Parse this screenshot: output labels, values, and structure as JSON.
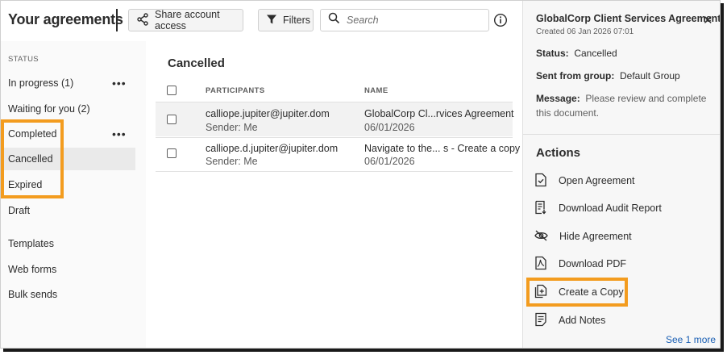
{
  "header": {
    "title": "Your agreements",
    "share_label": "Share account access",
    "filters_label": "Filters",
    "search_placeholder": "Search"
  },
  "sidebar": {
    "section_label": "STATUS",
    "items": [
      {
        "label": "In progress (1)"
      },
      {
        "label": "Waiting for you (2)"
      },
      {
        "label": "Completed"
      },
      {
        "label": "Cancelled"
      },
      {
        "label": "Expired"
      },
      {
        "label": "Draft"
      },
      {
        "label": "Templates"
      },
      {
        "label": "Web forms"
      },
      {
        "label": "Bulk sends"
      }
    ],
    "selected": "Cancelled",
    "highlighted": [
      "Completed",
      "Cancelled",
      "Expired"
    ]
  },
  "list": {
    "heading": "Cancelled",
    "columns": [
      "PARTICIPANTS",
      "NAME"
    ],
    "rows": [
      {
        "participant": "calliope.jupiter@jupiter.dom",
        "sender": "Sender: Me",
        "name": "GlobalCorp Cl...rvices Agreement",
        "date": "06/01/2026"
      },
      {
        "participant": "calliope.d.jupiter@jupiter.dom",
        "sender": "Sender: Me",
        "name": "Navigate to the... s - Create a copy",
        "date": "06/01/2026"
      }
    ]
  },
  "details": {
    "title": "GlobalCorp Client Services Agreement",
    "created": "Created 06 Jan 2026 07:01",
    "status_label": "Status:",
    "status_value": "Cancelled",
    "group_label": "Sent from group:",
    "group_value": "Default Group",
    "message_label": "Message:",
    "message_value": "Please review and complete this document.",
    "actions_title": "Actions",
    "actions": [
      {
        "label": "Open Agreement",
        "icon": "document-check-icon"
      },
      {
        "label": "Download Audit Report",
        "icon": "audit-report-icon"
      },
      {
        "label": "Hide Agreement",
        "icon": "eye-hidden-icon"
      },
      {
        "label": "Download PDF",
        "icon": "pdf-download-icon"
      },
      {
        "label": "Create a Copy",
        "icon": "copy-icon"
      },
      {
        "label": "Add Notes",
        "icon": "notes-icon"
      }
    ],
    "highlighted_action": "Create a Copy",
    "see_more": "See 1 more"
  },
  "colors": {
    "highlight": "#f39c1f",
    "link": "#1a5fb4",
    "selected_bg": "#eaeaea"
  }
}
